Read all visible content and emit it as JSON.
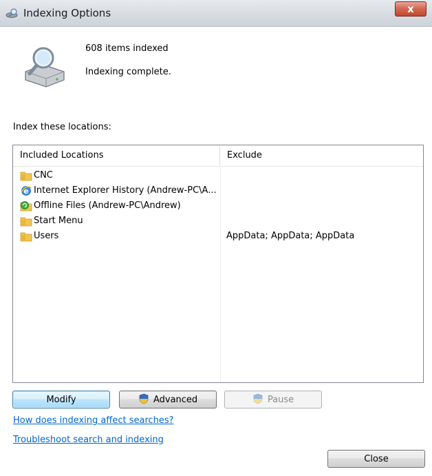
{
  "window": {
    "title": "Indexing Options",
    "close_glyph": "x"
  },
  "status": {
    "items_indexed": "608 items indexed",
    "state": "Indexing complete."
  },
  "locations": {
    "heading": "Index these locations:",
    "columns": {
      "included": "Included Locations",
      "exclude": "Exclude"
    },
    "rows": [
      {
        "icon": "folder-icon",
        "name": "CNC",
        "exclude": ""
      },
      {
        "icon": "ie-icon",
        "name": "Internet Explorer History (Andrew-PC\\A...",
        "exclude": ""
      },
      {
        "icon": "offline-files-icon",
        "name": "Offline Files (Andrew-PC\\Andrew)",
        "exclude": ""
      },
      {
        "icon": "folder-icon",
        "name": "Start Menu",
        "exclude": ""
      },
      {
        "icon": "folder-icon",
        "name": "Users",
        "exclude": "AppData; AppData; AppData"
      }
    ]
  },
  "buttons": {
    "modify": "Modify",
    "advanced": "Advanced",
    "pause": "Pause",
    "close": "Close"
  },
  "links": {
    "affect": "How does indexing affect searches?",
    "troubleshoot": "Troubleshoot search and indexing"
  },
  "colors": {
    "link": "#0066cc",
    "accent_button_border": "#3c7fb1",
    "close_red": "#c2462d"
  }
}
